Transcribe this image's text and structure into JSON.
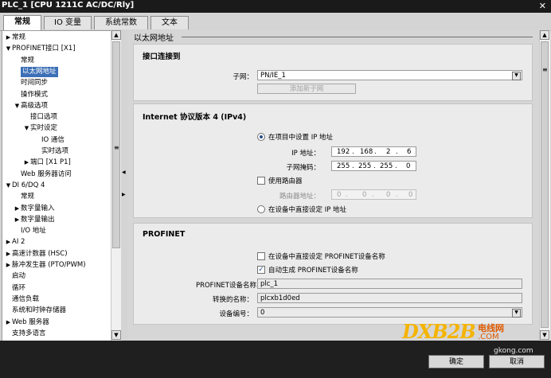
{
  "title": "PLC_1 [CPU 1211C AC/DC/Rly]",
  "tabs": [
    "常规",
    "IO 变量",
    "系统常数",
    "文本"
  ],
  "tree": [
    {
      "label": "常规",
      "level": 0,
      "arrow": "right",
      "selected": false
    },
    {
      "label": "PROFINET接口 [X1]",
      "level": 0,
      "arrow": "down",
      "selected": false
    },
    {
      "label": "常规",
      "level": 1,
      "arrow": "",
      "selected": false
    },
    {
      "label": "以太网地址",
      "level": 1,
      "arrow": "",
      "selected": true
    },
    {
      "label": "时间同步",
      "level": 1,
      "arrow": "",
      "selected": false
    },
    {
      "label": "操作模式",
      "level": 1,
      "arrow": "",
      "selected": false
    },
    {
      "label": "高级选项",
      "level": 1,
      "arrow": "down",
      "selected": false
    },
    {
      "label": "接口选项",
      "level": 2,
      "arrow": "",
      "selected": false
    },
    {
      "label": "实时设定",
      "level": 2,
      "arrow": "down",
      "selected": false
    },
    {
      "label": "IO 通信",
      "level": 3,
      "arrow": "",
      "selected": false
    },
    {
      "label": "实时选项",
      "level": 3,
      "arrow": "",
      "selected": false
    },
    {
      "label": "端口 [X1 P1]",
      "level": 2,
      "arrow": "right",
      "selected": false
    },
    {
      "label": "Web 服务器访问",
      "level": 1,
      "arrow": "",
      "selected": false
    },
    {
      "label": "DI 6/DQ 4",
      "level": 0,
      "arrow": "down",
      "selected": false
    },
    {
      "label": "常规",
      "level": 1,
      "arrow": "",
      "selected": false
    },
    {
      "label": "数字量输入",
      "level": 1,
      "arrow": "right",
      "selected": false
    },
    {
      "label": "数字量输出",
      "level": 1,
      "arrow": "right",
      "selected": false
    },
    {
      "label": "I/O 地址",
      "level": 1,
      "arrow": "",
      "selected": false
    },
    {
      "label": "AI 2",
      "level": 0,
      "arrow": "right",
      "selected": false
    },
    {
      "label": "高速计数器 (HSC)",
      "level": 0,
      "arrow": "right",
      "selected": false
    },
    {
      "label": "脉冲发生器 (PTO/PWM)",
      "level": 0,
      "arrow": "right",
      "selected": false
    },
    {
      "label": "启动",
      "level": 0,
      "arrow": "",
      "selected": false
    },
    {
      "label": "循环",
      "level": 0,
      "arrow": "",
      "selected": false
    },
    {
      "label": "通信负载",
      "level": 0,
      "arrow": "",
      "selected": false
    },
    {
      "label": "系统和时钟存储器",
      "level": 0,
      "arrow": "",
      "selected": false
    },
    {
      "label": "Web 服务器",
      "level": 0,
      "arrow": "right",
      "selected": false
    },
    {
      "label": "支持多语言",
      "level": 0,
      "arrow": "",
      "selected": false
    }
  ],
  "main": {
    "header": "以太网地址",
    "connect": {
      "title": "接口连接到",
      "subnet_label": "子网：",
      "subnet_value": "PN/IE_1",
      "add_subnet_button": "添加新子网"
    },
    "ipv4": {
      "title": "Internet 协议版本 4 (IPv4)",
      "set_in_project": "在项目中设置 IP 地址",
      "ip_label": "IP 地址：",
      "ip": [
        "192",
        "168",
        "2",
        "6"
      ],
      "mask_label": "子网掩码：",
      "mask": [
        "255",
        "255",
        "255",
        "0"
      ],
      "use_router": "使用路由器",
      "router_label": "路由器地址：",
      "router": [
        "0",
        "0",
        "0",
        "0"
      ],
      "set_directly": "在设备中直接设定 IP 地址"
    },
    "profinet": {
      "title": "PROFINET",
      "set_name_directly": "在设备中直接设定 PROFINET设备名称",
      "auto_generate": "自动生成 PROFINET设备名称",
      "device_name_label": "PROFINET设备名称",
      "device_name": "plc_1",
      "converted_label": "转换的名称：",
      "converted": "plcxb1d0ed",
      "device_number_label": "设备编号：",
      "device_number": "0"
    }
  },
  "footer": {
    "ok": "确定",
    "cancel": "取消"
  },
  "watermark": {
    "brand": "DXB2B",
    "cn": "电线网",
    "com": ".COM",
    "site": "gkong.com"
  }
}
